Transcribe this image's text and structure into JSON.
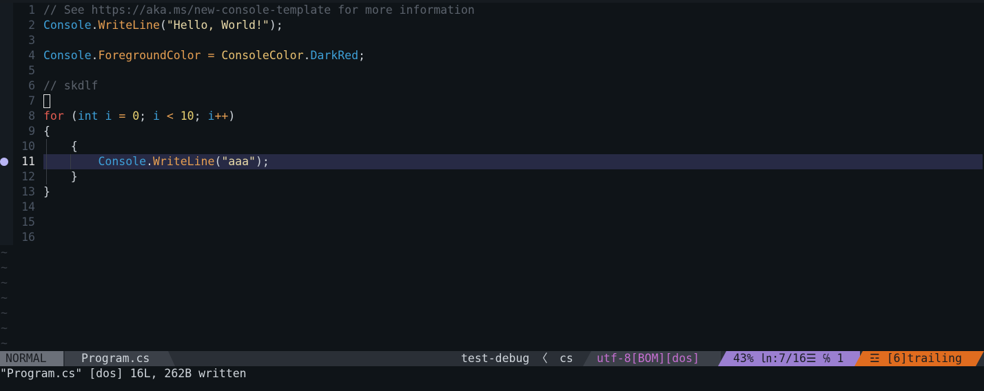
{
  "editor": {
    "lines": [
      {
        "n": "1",
        "tokens": [
          [
            "t-comment",
            "// See https://aka.ms/new-console-template for more information"
          ]
        ]
      },
      {
        "n": "2",
        "tokens": [
          [
            "t-class",
            "Console"
          ],
          [
            "t-punc",
            "."
          ],
          [
            "t-method",
            "WriteLine"
          ],
          [
            "t-punc",
            "("
          ],
          [
            "t-str",
            "\"Hello, World!\""
          ],
          [
            "t-punc",
            ");"
          ]
        ]
      },
      {
        "n": "3",
        "tokens": []
      },
      {
        "n": "4",
        "tokens": [
          [
            "t-class",
            "Console"
          ],
          [
            "t-punc",
            "."
          ],
          [
            "t-prop",
            "ForegroundColor"
          ],
          [
            "t-plain",
            " "
          ],
          [
            "t-op",
            "="
          ],
          [
            "t-plain",
            " "
          ],
          [
            "t-enum",
            "ConsoleColor"
          ],
          [
            "t-punc",
            "."
          ],
          [
            "t-member",
            "DarkRed"
          ],
          [
            "t-punc",
            ";"
          ]
        ]
      },
      {
        "n": "5",
        "tokens": []
      },
      {
        "n": "6",
        "tokens": [
          [
            "t-comment",
            "// skdlf"
          ]
        ]
      },
      {
        "n": "7",
        "tokens": [],
        "cursor": true
      },
      {
        "n": "8",
        "tokens": [
          [
            "t-kw",
            "for"
          ],
          [
            "t-plain",
            " ("
          ],
          [
            "t-type",
            "int"
          ],
          [
            "t-plain",
            " "
          ],
          [
            "t-var",
            "i"
          ],
          [
            "t-plain",
            " "
          ],
          [
            "t-op",
            "="
          ],
          [
            "t-plain",
            " "
          ],
          [
            "t-num",
            "0"
          ],
          [
            "t-punc",
            ";"
          ],
          [
            "t-plain",
            " "
          ],
          [
            "t-var",
            "i"
          ],
          [
            "t-plain",
            " "
          ],
          [
            "t-op",
            "<"
          ],
          [
            "t-plain",
            " "
          ],
          [
            "t-num",
            "10"
          ],
          [
            "t-punc",
            ";"
          ],
          [
            "t-plain",
            " "
          ],
          [
            "t-var",
            "i"
          ],
          [
            "t-op",
            "++"
          ],
          [
            "t-plain",
            ")"
          ]
        ]
      },
      {
        "n": "9",
        "tokens": [
          [
            "t-plain",
            "{"
          ]
        ]
      },
      {
        "n": "10",
        "tokens": [
          [
            "t-plain",
            "    {"
          ]
        ],
        "guides": [
          1
        ]
      },
      {
        "n": "11",
        "tokens": [
          [
            "t-plain",
            "        "
          ],
          [
            "t-class",
            "Console"
          ],
          [
            "t-punc",
            "."
          ],
          [
            "t-method",
            "WriteLine"
          ],
          [
            "t-punc",
            "("
          ],
          [
            "t-str",
            "\"aaa\""
          ],
          [
            "t-punc",
            ");"
          ]
        ],
        "current": true,
        "breakpoint": true,
        "guides": [
          1,
          2
        ]
      },
      {
        "n": "12",
        "tokens": [
          [
            "t-plain",
            "    }"
          ]
        ],
        "guides": [
          1
        ]
      },
      {
        "n": "13",
        "tokens": [
          [
            "t-plain",
            "}"
          ]
        ]
      },
      {
        "n": "14",
        "tokens": []
      },
      {
        "n": "15",
        "tokens": []
      },
      {
        "n": "16",
        "tokens": []
      }
    ],
    "tilde_count": 7,
    "tilde_char": "~"
  },
  "statusline": {
    "mode": "NORMAL",
    "filename": "Program.cs",
    "branch": "test-debug",
    "branch_sep": "〈",
    "filetype": "cs",
    "encoding": "utf-8[BOM][dos]",
    "position": "43% ㏑:7/16☰ ℅ 1",
    "warning": "☲ [6]trailing"
  },
  "cmdline": {
    "message": "\"Program.cs\" [dos] 16L, 262B written"
  },
  "colors": {
    "background": "#0f1418",
    "current_line": "#272a45",
    "breakpoint": "#b9b6f5",
    "mode_bg": "#6b7079",
    "position_bg": "#9b7fd1",
    "warning_bg": "#e06c1f",
    "encoding_fg": "#c66fd2"
  }
}
